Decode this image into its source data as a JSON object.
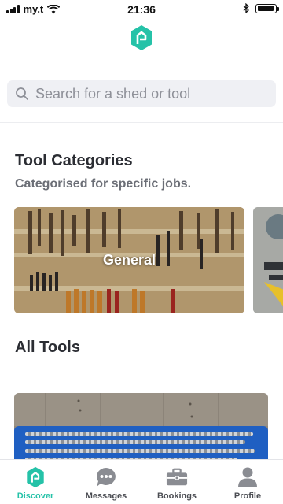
{
  "status_bar": {
    "carrier": "my.t",
    "time": "21:36",
    "battery_level": 0.95
  },
  "search": {
    "placeholder": "Search for a shed or tool",
    "value": ""
  },
  "categories_section": {
    "title": "Tool Categories",
    "subtitle": "Categorised for specific jobs.",
    "cards": [
      {
        "label": "General"
      },
      {
        "label": ""
      }
    ]
  },
  "all_tools_section": {
    "title": "All Tools"
  },
  "nav": {
    "items": [
      {
        "label": "Discover",
        "icon": "discover-icon",
        "active": true
      },
      {
        "label": "Messages",
        "icon": "chat-icon",
        "active": false
      },
      {
        "label": "Bookings",
        "icon": "toolbox-icon",
        "active": false
      },
      {
        "label": "Profile",
        "icon": "person-icon",
        "active": false
      }
    ]
  },
  "colors": {
    "accent": "#25c2a8",
    "text": "#2b2d33",
    "muted": "#6b6e76",
    "search_bg": "#eff0f4"
  }
}
